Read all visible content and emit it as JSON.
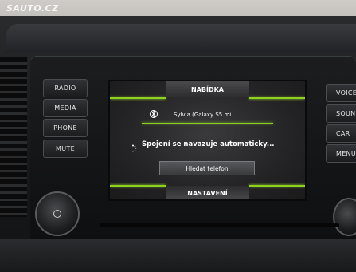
{
  "watermark": "SAUTO.CZ",
  "hardware_buttons": {
    "left": [
      "RADIO",
      "MEDIA",
      "PHONE",
      "MUTE"
    ],
    "right": [
      "VOICE",
      "SOUND",
      "CAR",
      "MENU"
    ]
  },
  "screen": {
    "top_tab": "NABÍDKA",
    "bottom_tab": "NASTAVENÍ",
    "device_name": "Sylvia (Galaxy S5 mi",
    "status": "Spojení se navazuje automaticky...",
    "find_button": "Hledat telefon",
    "accent_color": "#8fd020"
  },
  "icons": {
    "bluetooth": "bluetooth-icon",
    "spinner": "loading-spinner-icon",
    "power": "power-icon"
  }
}
